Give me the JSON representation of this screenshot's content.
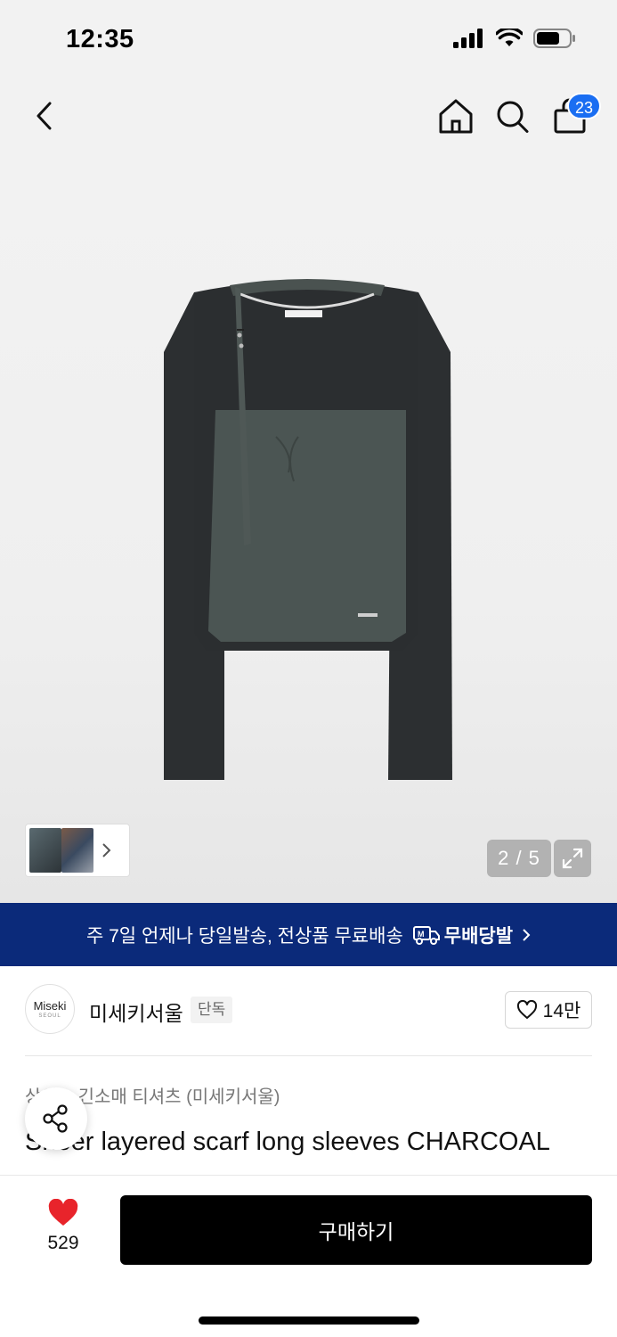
{
  "status_bar": {
    "time": "12:35"
  },
  "nav": {
    "back_icon": "chevron-left-icon",
    "home_icon": "home-icon",
    "search_icon": "search-icon",
    "cart_icon": "shopping-bag-icon",
    "cart_count": "23"
  },
  "gallery": {
    "page_indicator": "2 / 5",
    "current_page": 2,
    "total_pages": 5
  },
  "promo_banner": {
    "text": "주 7일 언제나 당일발송, 전상품 무료배송",
    "logo_text": "무배당발"
  },
  "brand": {
    "logo_text": "Miseki",
    "logo_subtext": "SEOUL",
    "name": "미세키서울",
    "tag": "단독",
    "like_count": "14만"
  },
  "product": {
    "category": "상의 > 긴소매 티셔츠 (미세키서울)",
    "title": "Sheer layered scarf long sleeves CHARCOAL"
  },
  "bottom_bar": {
    "wish_count": "529",
    "buy_label": "구매하기"
  },
  "colors": {
    "banner_bg": "#0b2a7a",
    "badge_bg": "#1a6ef2",
    "heart": "#e8242b",
    "buy_bg": "#000000"
  }
}
